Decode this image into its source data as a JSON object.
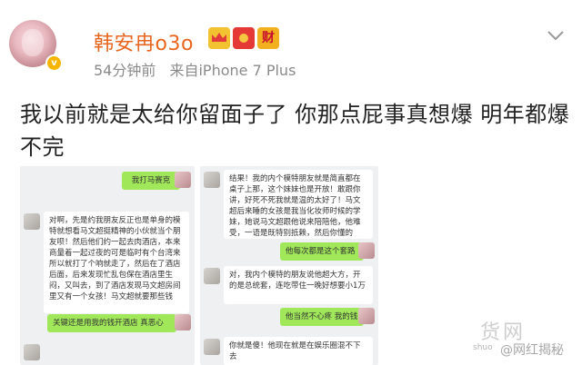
{
  "user": {
    "name": "韩安冉o3o",
    "verified_mark": "v",
    "badge_cai": "财"
  },
  "meta": {
    "time": "54分钟前",
    "source": "来自iPhone 7 Plus"
  },
  "post": {
    "text": "我以前就是太给你留面子了 你那点屁事真想爆 明年都爆不完"
  },
  "screenshot_left": {
    "bubbles": [
      "我打马赛克",
      "对啊，先是约我朋友反正也是单身的模特就想看马文超挺精神的小伙就当个朋友呗！然后他们约一起去肉酒店，本来商量着一起过夜的可是临时有个台湾来所以就打了个响就走了，然后在了酒店后面，后来发现忙乱包保在酒店里生闷，又叫去，到了酒店发现马文超房间里又有一个女孩！马文超就要那些钱",
      "关键还是用我的钱开酒店 真恶心"
    ]
  },
  "screenshot_right": {
    "bubbles": [
      "结果！我的内个模特朋友就是简直都在桌子上那，这个妹妹也是开放！敢跟你讲，好死不死我就是温的太好了！马文超后来睡的女孩是我当化妆师时候的学妹，她说马文超跟他说来陪陪他，他难受，一语是既特别抵赖，然后你懂的",
      "他每次都是这个套路",
      "对，我内个模特的朋友说他超大方，开的是总统套，连吃带住一晚好想要小1万",
      "他当然不心疼 我的钱",
      "你就是傻！他现在就是在娱乐圈混不下去"
    ]
  },
  "watermark": {
    "main": "货网",
    "site": "shuo",
    "sub": "@网红揭秘"
  }
}
